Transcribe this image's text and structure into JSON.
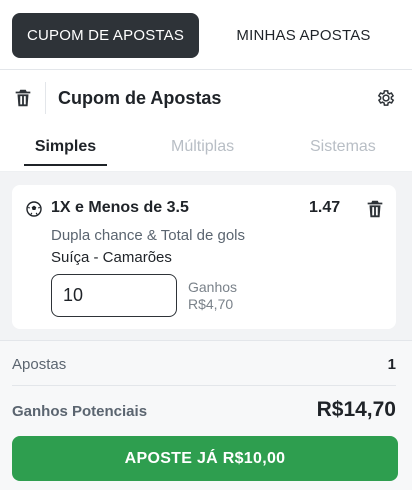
{
  "tabs": {
    "betslip_label": "CUPOM DE APOSTAS",
    "my_bets_label": "MINHAS APOSTAS"
  },
  "header": {
    "title": "Cupom de Apostas",
    "trash_icon": "trash-icon",
    "settings_icon": "gear-icon"
  },
  "subtabs": {
    "singles": "Simples",
    "multiples": "Múltiplas",
    "systems": "Sistemas"
  },
  "bet": {
    "sport_icon": "soccer-ball-icon",
    "selection": "1X e Menos de 3.5",
    "odds": "1.47",
    "market": "Dupla chance & Total de gols",
    "event": "Suíça - Camarões",
    "stake": "10",
    "winnings_label": "Ganhos",
    "winnings_value": "R$4,70"
  },
  "summary": {
    "bets_label": "Apostas",
    "bets_count": "1",
    "potential_label": "Ganhos Potenciais",
    "potential_value": "R$14,70",
    "place_button": "APOSTE JÁ R$10,00"
  },
  "colors": {
    "dark": "#2e3338",
    "accent_green": "#2e9e4f",
    "muted": "#b8bec5"
  }
}
